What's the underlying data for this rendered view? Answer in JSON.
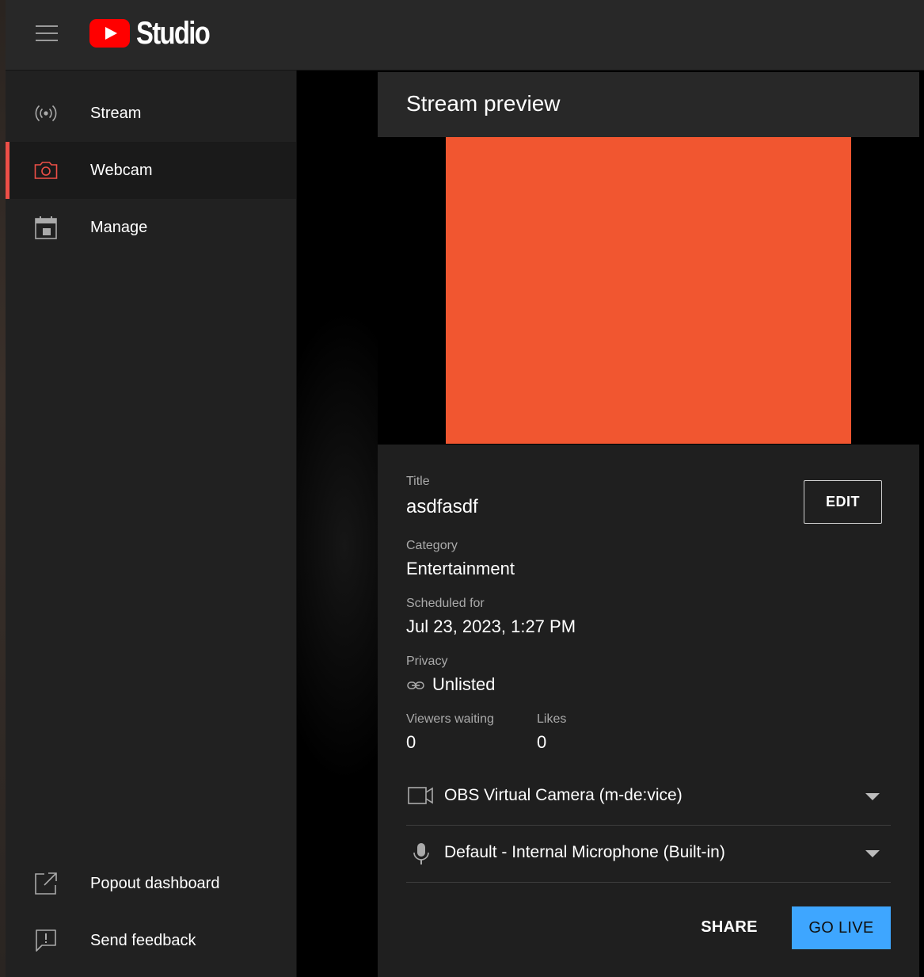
{
  "app": {
    "logo_text": "Studio",
    "accent": "#ee4f47",
    "brand": "#ff0000"
  },
  "sidebar": {
    "items": [
      {
        "label": "Stream",
        "icon": "broadcast-icon"
      },
      {
        "label": "Webcam",
        "icon": "camera-icon",
        "active": true
      },
      {
        "label": "Manage",
        "icon": "calendar-icon"
      }
    ],
    "footer": [
      {
        "label": "Popout dashboard",
        "icon": "open-external-icon"
      },
      {
        "label": "Send feedback",
        "icon": "feedback-icon"
      }
    ]
  },
  "preview": {
    "title": "Stream preview",
    "video_color": "#f15630"
  },
  "details": {
    "title_label": "Title",
    "title_value": "asdfasdf",
    "edit_label": "EDIT",
    "category_label": "Category",
    "category_value": "Entertainment",
    "scheduled_label": "Scheduled for",
    "scheduled_value": "Jul 23, 2023, 1:27 PM",
    "privacy_label": "Privacy",
    "privacy_value": "Unlisted",
    "viewers_label": "Viewers waiting",
    "viewers_value": "0",
    "likes_label": "Likes",
    "likes_value": "0"
  },
  "devices": {
    "camera": "OBS Virtual Camera (m-de:vice)",
    "microphone": "Default - Internal Microphone (Built-in)"
  },
  "actions": {
    "share_label": "SHARE",
    "golive_label": "GO LIVE",
    "golive_color": "#3ea6ff"
  }
}
